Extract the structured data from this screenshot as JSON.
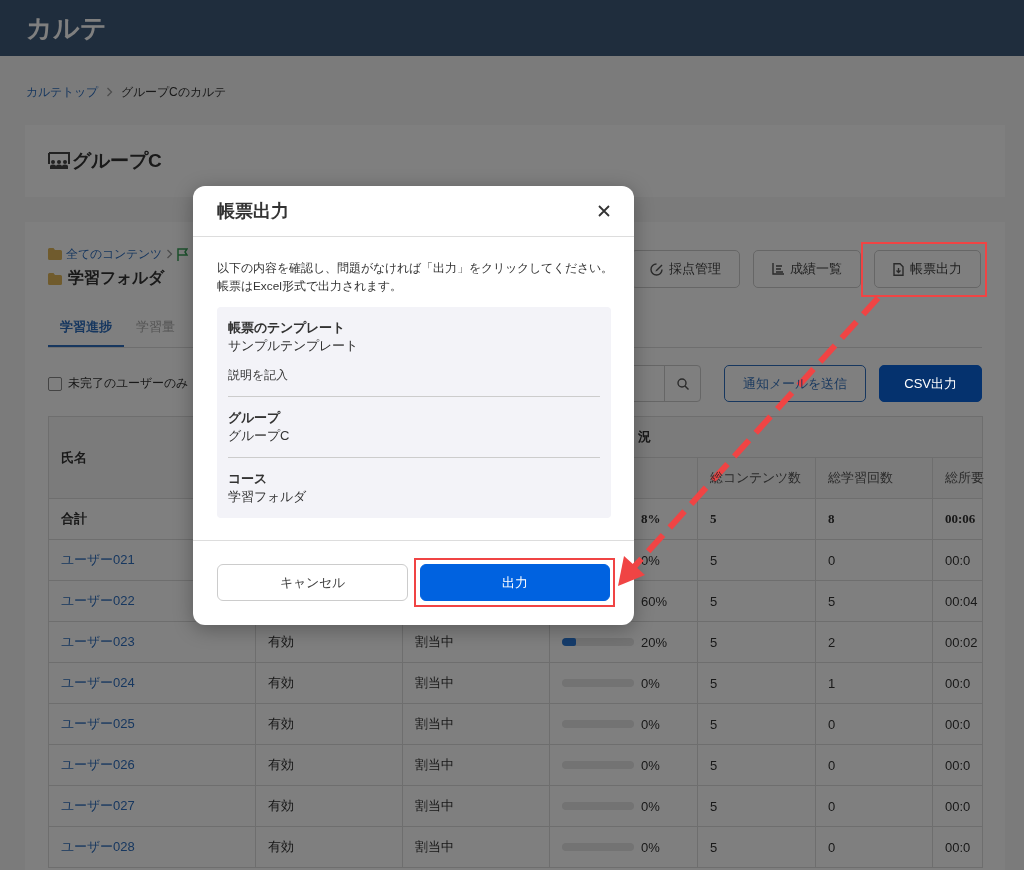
{
  "header": {
    "title": "カルテ"
  },
  "breadcrumb": [
    {
      "label": "カルテトップ",
      "link": true
    },
    {
      "label": "グループCのカルテ",
      "link": false
    }
  ],
  "group_card": {
    "title": "グループC"
  },
  "content": {
    "path": [
      "全てのコンテンツ"
    ],
    "folder": "学習フォルダ",
    "actions": [
      {
        "label": "採点管理",
        "annotated": false
      },
      {
        "label": "成績一覧",
        "annotated": false
      },
      {
        "label": "帳票出力",
        "annotated": true
      }
    ]
  },
  "tabs": [
    {
      "label": "学習進捗",
      "selected": true
    },
    {
      "label": "学習量",
      "selected": false
    }
  ],
  "filter": {
    "label": "未完了のユーザーのみ",
    "checked": false
  },
  "toolbar_buttons": [
    {
      "label": "通知メールを送信",
      "kind": "outline"
    },
    {
      "label": "CSV出力",
      "kind": "primary"
    }
  ],
  "table": {
    "group_header": "況",
    "columns": {
      "name": "氏名",
      "contents": "総コンテンツ数",
      "sessions": "総学習回数",
      "time": "総所要"
    },
    "total": {
      "name": "合計",
      "progress": "8%",
      "contents": "5",
      "sessions": "8",
      "time": "00:06"
    },
    "rows": [
      {
        "name": "ユーザー021",
        "progress": "0%",
        "contents": "5",
        "sessions": "0",
        "time": "00:0"
      },
      {
        "name": "ユーザー022",
        "progress": "60%",
        "contents": "5",
        "sessions": "5",
        "time": "00:04"
      },
      {
        "name": "ユーザー023",
        "status": "有効",
        "assignment": "割当中",
        "level": 0.2,
        "progress": "20%",
        "contents": "5",
        "sessions": "2",
        "time": "00:02"
      },
      {
        "name": "ユーザー024",
        "status": "有効",
        "assignment": "割当中",
        "level": 0,
        "progress": "0%",
        "contents": "5",
        "sessions": "1",
        "time": "00:0"
      },
      {
        "name": "ユーザー025",
        "status": "有効",
        "assignment": "割当中",
        "level": 0,
        "progress": "0%",
        "contents": "5",
        "sessions": "0",
        "time": "00:0"
      },
      {
        "name": "ユーザー026",
        "status": "有効",
        "assignment": "割当中",
        "level": 0,
        "progress": "0%",
        "contents": "5",
        "sessions": "0",
        "time": "00:0"
      },
      {
        "name": "ユーザー027",
        "status": "有効",
        "assignment": "割当中",
        "level": 0,
        "progress": "0%",
        "contents": "5",
        "sessions": "0",
        "time": "00:0"
      },
      {
        "name": "ユーザー028",
        "status": "有効",
        "assignment": "割当中",
        "level": 0,
        "progress": "0%",
        "contents": "5",
        "sessions": "0",
        "time": "00:0"
      }
    ]
  },
  "dialog": {
    "title": "帳票出力",
    "message_lines": [
      "以下の内容を確認し、問題がなければ「出力」をクリックしてください。",
      "帳票はExcel形式で出力されます。"
    ],
    "details": [
      {
        "label": "帳票のテンプレート",
        "value": "サンプルテンプレート",
        "note": "説明を記入"
      },
      {
        "label": "グループ",
        "value": "グループC"
      },
      {
        "label": "コース",
        "value": "学習フォルダ"
      }
    ],
    "buttons": [
      {
        "label": "キャンセル",
        "kind": "secondary",
        "annotated": false
      },
      {
        "label": "出力",
        "kind": "primary",
        "annotated": true
      }
    ]
  }
}
